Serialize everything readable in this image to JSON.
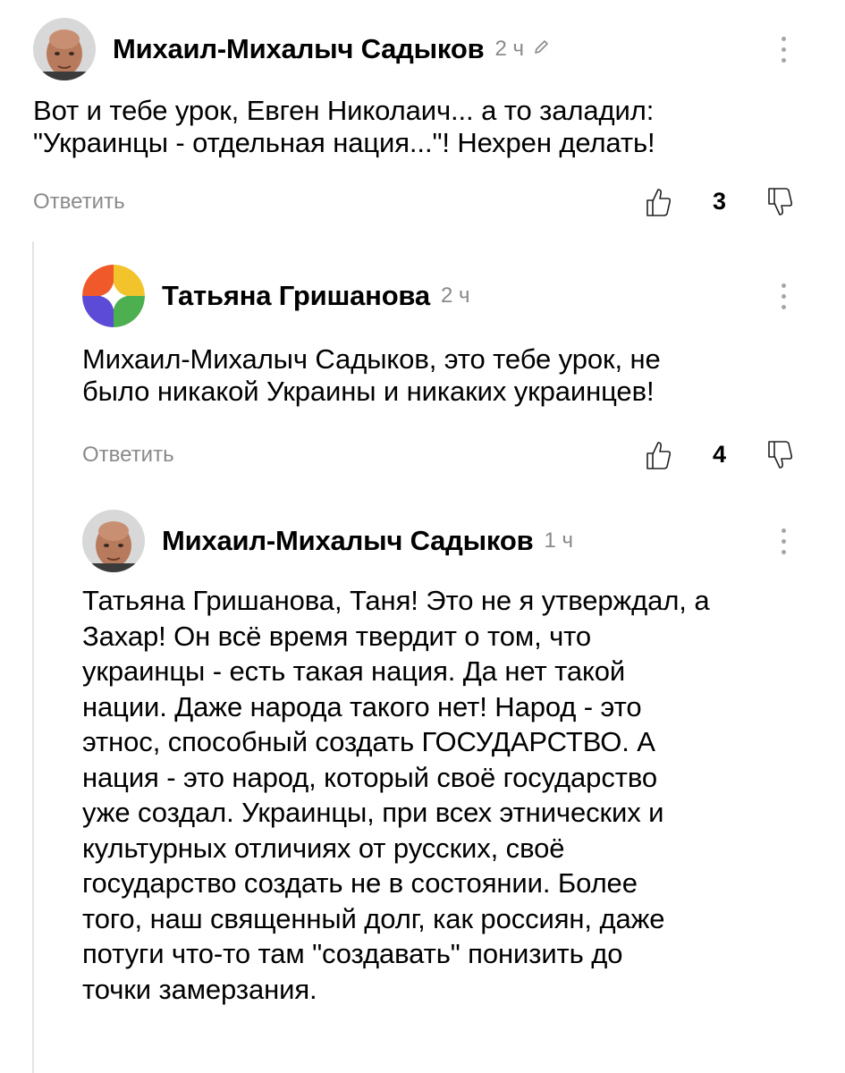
{
  "comments": [
    {
      "author": "Михаил-Михалыч Садыков",
      "time": "2 ч",
      "lines": [
        "Вот и тебе урок, Евген Николаич... а то заладил:",
        "\"Украинцы - отдельная нация...\"! Нехрен делать!"
      ],
      "reply": "Ответить",
      "likes": "3"
    },
    {
      "author": "Татьяна Гришанова",
      "time": "2 ч",
      "lines": [
        "Михаил-Михалыч Садыков, это тебе урок, не",
        "было никакой Украины и никаких украинцев!"
      ],
      "reply": "Ответить",
      "likes": "4"
    },
    {
      "author": "Михаил-Михалыч Садыков",
      "time": "1 ч",
      "lines": [
        "Татьяна Гришанова, Таня! Это не я утверждал, а",
        "Захар! Он всё время твердит о том, что",
        "украинцы - есть такая нация. Да нет такой",
        "нации. Даже народа такого нет! Народ - это",
        "этнос, способный создать ГОСУДАРСТВО. А",
        "нация - это народ, который своё государство",
        "уже создал. Украинцы, при всех этнических и",
        "культурных отличиях от русских, своё",
        "государство создать не в состоянии. Более",
        "того, наш священный долг, как россиян, даже",
        "потуги что-то там \"создавать\" понизить до",
        "точки замерзания."
      ]
    }
  ]
}
